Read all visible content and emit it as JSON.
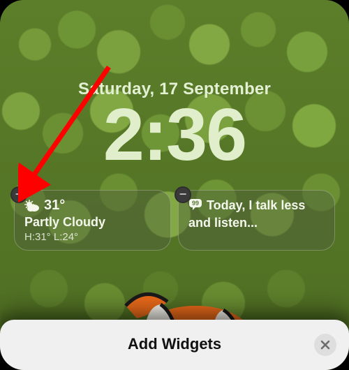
{
  "date": "Saturday, 17 September",
  "time": "2:36",
  "widgets": {
    "weather": {
      "temp": "31°",
      "condition": "Partly Cloudy",
      "hilo": "H:31° L:24°"
    },
    "quote": {
      "text": "Today, I talk less and listen..."
    }
  },
  "sheet": {
    "title": "Add Widgets"
  },
  "annotation": {
    "type": "arrow-pointer",
    "color": "#ff0000"
  }
}
